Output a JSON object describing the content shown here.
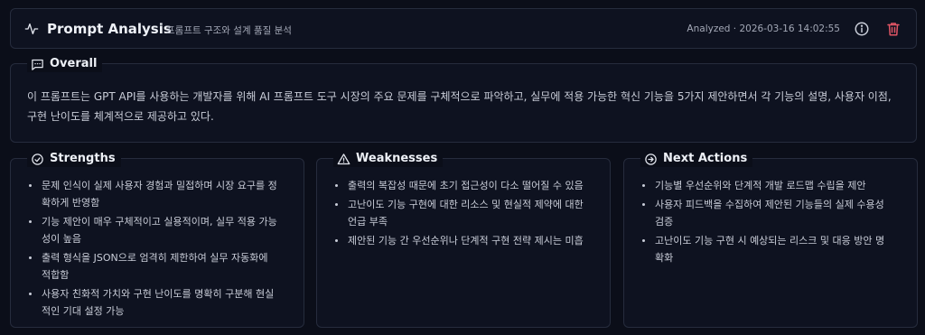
{
  "header": {
    "title": "Prompt Analysis",
    "subtitle": "프롬프트 구조와 설계 품질 분석",
    "status": "Analyzed · 2026-03-16 14:02:55"
  },
  "overall": {
    "label": "Overall",
    "text": "이 프롬프트는 GPT API를 사용하는 개발자를 위해 AI 프롬프트 도구 시장의 주요 문제를 구체적으로 파악하고, 실무에 적용 가능한 혁신 기능을 5가지 제안하면서 각 기능의 설명, 사용자 이점, 구현 난이도를 체계적으로 제공하고 있다."
  },
  "strengths": {
    "label": "Strengths",
    "items": [
      "문제 인식이 실제 사용자 경험과 밀접하며 시장 요구를 정확하게 반영함",
      "기능 제안이 매우 구체적이고 실용적이며, 실무 적용 가능성이 높음",
      "출력 형식을 JSON으로 엄격히 제한하여 실무 자동화에 적합함",
      "사용자 친화적 가치와 구현 난이도를 명확히 구분해 현실적인 기대 설정 가능"
    ]
  },
  "weaknesses": {
    "label": "Weaknesses",
    "items": [
      "출력의 복잡성 때문에 초기 접근성이 다소 떨어질 수 있음",
      "고난이도 기능 구현에 대한 리소스 및 현실적 제약에 대한 언급 부족",
      "제안된 기능 간 우선순위나 단계적 구현 전략 제시는 미흡"
    ]
  },
  "next_actions": {
    "label": "Next Actions",
    "items": [
      "기능별 우선순위와 단계적 개발 로드맵 수립을 제안",
      "사용자 피드백을 수집하여 제안된 기능들의 실제 수용성 검증",
      "고난이도 기능 구현 시 예상되는 리스크 및 대응 방안 명확화"
    ]
  },
  "icons": {
    "header": "pulse-icon",
    "info": "info-icon",
    "delete": "trash-icon",
    "overall": "message-square-icon",
    "strengths": "check-circle-icon",
    "weaknesses": "alert-triangle-icon",
    "next_actions": "arrow-right-circle-icon"
  },
  "colors": {
    "background": "#0b0e19",
    "panel": "#0e1220",
    "border": "#262c3d",
    "delete": "#e05565",
    "text": "#c9cdd8",
    "heading": "#eef1f7"
  }
}
